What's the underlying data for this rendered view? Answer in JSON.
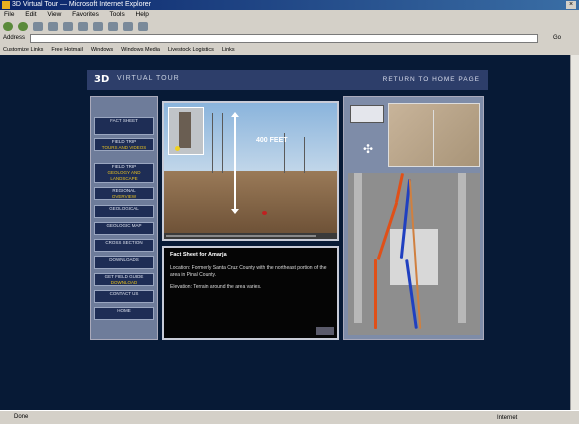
{
  "browser": {
    "title": "3D Virtual Tour — Microsoft Internet Explorer",
    "menu": [
      "File",
      "Edit",
      "View",
      "Favorites",
      "Tools",
      "Help"
    ],
    "address_label": "Address",
    "go_label": "Go",
    "links": [
      "Customize Links",
      "Free Hotmail",
      "Windows",
      "Windows Media",
      "Livestock Logistics",
      "Links"
    ],
    "status": "Done",
    "zone": "Internet"
  },
  "page": {
    "logo": "3D",
    "site_title": "VIRTUAL TOUR",
    "home_link": "RETURN TO HOME PAGE",
    "nav": [
      {
        "label": "FACT SHEET",
        "sub": ""
      },
      {
        "label": "FIELD TRIP",
        "sub": "TOURS AND VIDEOS"
      },
      {
        "label": "FIELD TRIP",
        "sub": "GEOLOGY AND LANDSCAPE"
      },
      {
        "label": "REGIONAL",
        "sub": "OVERVIEW"
      },
      {
        "label": "GEOLOGICAL",
        "sub": ""
      },
      {
        "label": "GEOLOGIC MAP",
        "sub": ""
      },
      {
        "label": "CROSS SECTION",
        "sub": ""
      },
      {
        "label": "DOWNLOADS",
        "sub": ""
      },
      {
        "label": "GET FIELD GUIDE",
        "sub": "DOWNLOAD"
      },
      {
        "label": "CONTACT US",
        "sub": ""
      },
      {
        "label": "HOME",
        "sub": ""
      }
    ],
    "video": {
      "label": "400 FEET"
    },
    "info": {
      "title": "Fact Sheet for Amarja",
      "lines": [
        "Location: Formerly Santa Cruz County with the northeast portion of the area in Pinal County.",
        "Elevation: Terrain around the area varies."
      ]
    }
  },
  "colors": {
    "page_bg": "#071a36",
    "header": "#2d3e6a",
    "accent": "#e8c020"
  }
}
